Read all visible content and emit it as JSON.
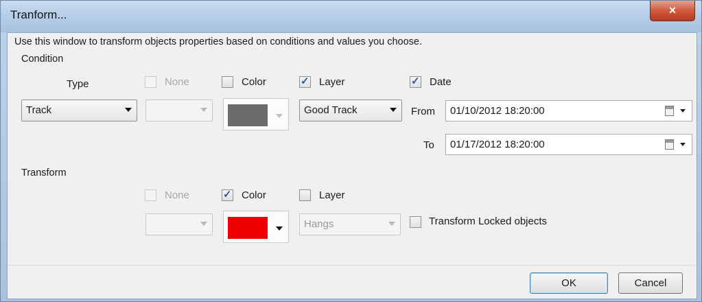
{
  "window": {
    "title": "Tranform...",
    "close_glyph": "×"
  },
  "description": "Use this window to transform objects properties based on conditions and values you choose.",
  "condition": {
    "group_label": "Condition",
    "type_label": "Type",
    "type_value": "Track",
    "none": {
      "label": "None",
      "checked": false,
      "enabled": false
    },
    "color": {
      "label": "Color",
      "checked": false,
      "value": "#6b6b6b"
    },
    "layer": {
      "label": "Layer",
      "checked": true,
      "value": "Good Track"
    },
    "date": {
      "label": "Date",
      "checked": true,
      "from_label": "From",
      "from_value": "01/10/2012 18:20:00",
      "to_label": "To",
      "to_value": "01/17/2012 18:20:00"
    }
  },
  "transform": {
    "group_label": "Transform",
    "none": {
      "label": "None",
      "checked": false,
      "enabled": false
    },
    "color": {
      "label": "Color",
      "checked": true,
      "value": "#ee0000"
    },
    "layer": {
      "label": "Layer",
      "checked": false,
      "value": "Hangs"
    },
    "locked": {
      "label": "Transform Locked objects",
      "checked": false
    }
  },
  "buttons": {
    "ok": "OK",
    "cancel": "Cancel"
  },
  "icons": {
    "check_glyph": "✓",
    "calendar": "calendar-icon"
  }
}
